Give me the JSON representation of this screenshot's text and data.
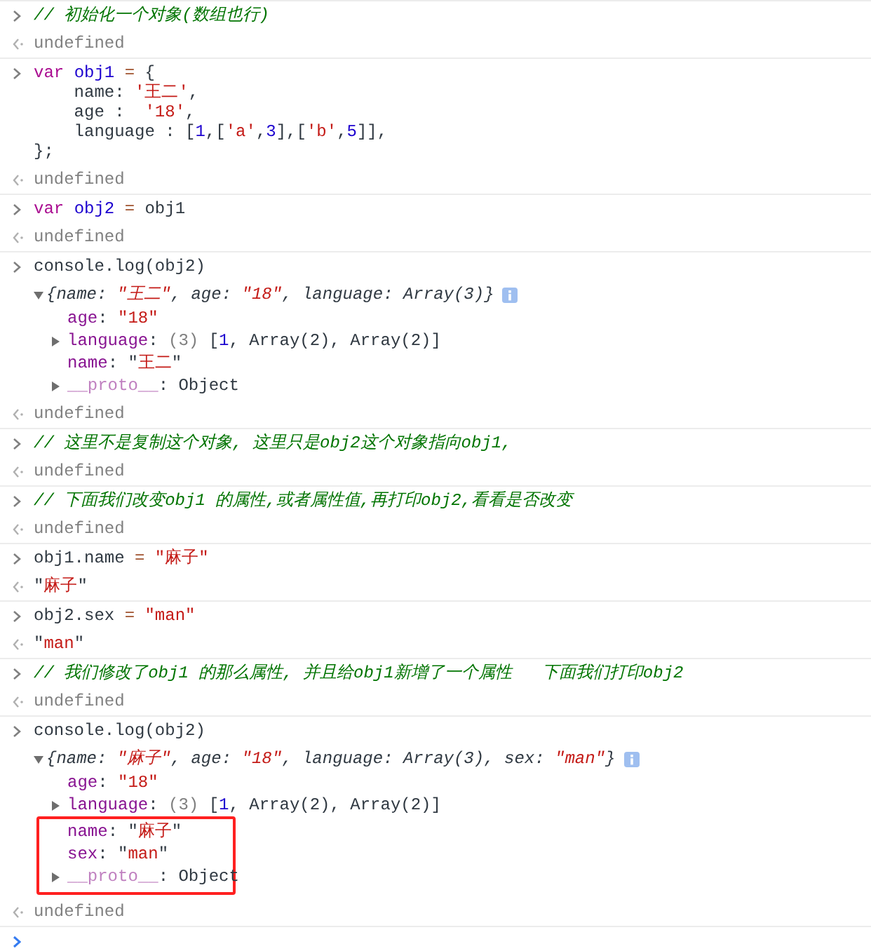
{
  "entries": [
    {
      "input": [
        [
          {
            "text": "// 初始化一个对象(数组也行)",
            "kind": "comment"
          }
        ]
      ],
      "output": [
        {
          "text": "undefined",
          "kind": "dim"
        }
      ]
    },
    {
      "input": [
        [
          {
            "text": "var ",
            "kind": "keyword"
          },
          {
            "text": "obj1 ",
            "kind": "ident"
          },
          {
            "text": "=",
            "kind": "op"
          },
          {
            "text": " {",
            "kind": "plain"
          }
        ],
        [
          {
            "text": "    name: ",
            "kind": "plain"
          },
          {
            "text": "'王二'",
            "kind": "string"
          },
          {
            "text": ",",
            "kind": "plain"
          }
        ],
        [
          {
            "text": "    age :  ",
            "kind": "plain"
          },
          {
            "text": "'18'",
            "kind": "string"
          },
          {
            "text": ",",
            "kind": "plain"
          }
        ],
        [
          {
            "text": "    language : [",
            "kind": "plain"
          },
          {
            "text": "1",
            "kind": "number"
          },
          {
            "text": ",[",
            "kind": "plain"
          },
          {
            "text": "'a'",
            "kind": "string"
          },
          {
            "text": ",",
            "kind": "plain"
          },
          {
            "text": "3",
            "kind": "number"
          },
          {
            "text": "],[",
            "kind": "plain"
          },
          {
            "text": "'b'",
            "kind": "string"
          },
          {
            "text": ",",
            "kind": "plain"
          },
          {
            "text": "5",
            "kind": "number"
          },
          {
            "text": "]],",
            "kind": "plain"
          }
        ],
        [
          {
            "text": "};",
            "kind": "plain"
          }
        ]
      ],
      "output": [
        {
          "text": "undefined",
          "kind": "dim"
        }
      ]
    },
    {
      "input": [
        [
          {
            "text": "var ",
            "kind": "keyword"
          },
          {
            "text": "obj2 ",
            "kind": "ident"
          },
          {
            "text": "=",
            "kind": "op"
          },
          {
            "text": " obj1",
            "kind": "plain"
          }
        ]
      ],
      "output": [
        {
          "text": "undefined",
          "kind": "dim"
        }
      ]
    },
    {
      "input": [
        [
          {
            "text": "console.log(obj2)",
            "kind": "plain"
          }
        ]
      ],
      "log": {
        "expanded": true,
        "summary": [
          {
            "text": "{name: ",
            "kind": "plain"
          },
          {
            "text": "\"王二\"",
            "kind": "string"
          },
          {
            "text": ", age: ",
            "kind": "plain"
          },
          {
            "text": "\"18\"",
            "kind": "string"
          },
          {
            "text": ", language: Array(3)}",
            "kind": "plain"
          }
        ],
        "props": [
          {
            "expandable": false,
            "highlighted": false,
            "tokens": [
              {
                "text": "age",
                "kind": "prop"
              },
              {
                "text": ": ",
                "kind": "plain"
              },
              {
                "text": "\"18\"",
                "kind": "string"
              }
            ]
          },
          {
            "expandable": true,
            "highlighted": false,
            "tokens": [
              {
                "text": "language",
                "kind": "prop"
              },
              {
                "text": ": ",
                "kind": "plain"
              },
              {
                "text": "(3)",
                "kind": "dim"
              },
              {
                "text": " [",
                "kind": "plain"
              },
              {
                "text": "1",
                "kind": "number"
              },
              {
                "text": ", Array(2), Array(2)]",
                "kind": "plain"
              }
            ]
          },
          {
            "expandable": false,
            "highlighted": false,
            "tokens": [
              {
                "text": "name",
                "kind": "prop"
              },
              {
                "text": ": \"",
                "kind": "plain"
              },
              {
                "text": "王二",
                "kind": "string"
              },
              {
                "text": "\"",
                "kind": "plain"
              }
            ]
          },
          {
            "expandable": true,
            "highlighted": false,
            "tokens": [
              {
                "text": "__proto__",
                "kind": "proto"
              },
              {
                "text": ": Object",
                "kind": "plain"
              }
            ]
          }
        ]
      },
      "output": [
        {
          "text": "undefined",
          "kind": "dim"
        }
      ]
    },
    {
      "input": [
        [
          {
            "text": "// 这里不是复制这个对象, 这里只是obj2这个对象指向obj1,",
            "kind": "comment"
          }
        ]
      ],
      "output": [
        {
          "text": "undefined",
          "kind": "dim"
        }
      ]
    },
    {
      "input": [
        [
          {
            "text": "// 下面我们改变obj1 的属性,或者属性值,再打印obj2,看看是否改变",
            "kind": "comment"
          }
        ]
      ],
      "output": [
        {
          "text": "undefined",
          "kind": "dim"
        }
      ]
    },
    {
      "input": [
        [
          {
            "text": "obj1.name ",
            "kind": "plain"
          },
          {
            "text": "= ",
            "kind": "op"
          },
          {
            "text": "\"麻子\"",
            "kind": "string"
          }
        ]
      ],
      "output": [
        {
          "text": "\"",
          "kind": "plain"
        },
        {
          "text": "麻子",
          "kind": "string"
        },
        {
          "text": "\"",
          "kind": "plain"
        }
      ]
    },
    {
      "input": [
        [
          {
            "text": "obj2.sex ",
            "kind": "plain"
          },
          {
            "text": "= ",
            "kind": "op"
          },
          {
            "text": "\"man\"",
            "kind": "string"
          }
        ]
      ],
      "output": [
        {
          "text": "\"",
          "kind": "plain"
        },
        {
          "text": "man",
          "kind": "string"
        },
        {
          "text": "\"",
          "kind": "plain"
        }
      ]
    },
    {
      "input": [
        [
          {
            "text": "// 我们修改了obj1 的那么属性, 并且给obj1新增了一个属性   下面我们打印obj2",
            "kind": "comment"
          }
        ]
      ],
      "output": [
        {
          "text": "undefined",
          "kind": "dim"
        }
      ]
    },
    {
      "input": [
        [
          {
            "text": "console.log(obj2)",
            "kind": "plain"
          }
        ]
      ],
      "log": {
        "expanded": true,
        "summary": [
          {
            "text": "{name: ",
            "kind": "plain"
          },
          {
            "text": "\"麻子\"",
            "kind": "string"
          },
          {
            "text": ", age: ",
            "kind": "plain"
          },
          {
            "text": "\"18\"",
            "kind": "string"
          },
          {
            "text": ", language: Array(3), sex: ",
            "kind": "plain"
          },
          {
            "text": "\"man\"",
            "kind": "string"
          },
          {
            "text": "}",
            "kind": "plain"
          }
        ],
        "props": [
          {
            "expandable": false,
            "highlighted": false,
            "tokens": [
              {
                "text": "age",
                "kind": "prop"
              },
              {
                "text": ": ",
                "kind": "plain"
              },
              {
                "text": "\"18\"",
                "kind": "string"
              }
            ]
          },
          {
            "expandable": true,
            "highlighted": false,
            "tokens": [
              {
                "text": "language",
                "kind": "prop"
              },
              {
                "text": ": ",
                "kind": "plain"
              },
              {
                "text": "(3)",
                "kind": "dim"
              },
              {
                "text": " [",
                "kind": "plain"
              },
              {
                "text": "1",
                "kind": "number"
              },
              {
                "text": ", Array(2), Array(2)]",
                "kind": "plain"
              }
            ]
          },
          {
            "expandable": false,
            "highlighted": true,
            "tokens": [
              {
                "text": "name",
                "kind": "prop"
              },
              {
                "text": ": \"",
                "kind": "plain"
              },
              {
                "text": "麻子",
                "kind": "string"
              },
              {
                "text": "\"",
                "kind": "plain"
              }
            ]
          },
          {
            "expandable": false,
            "highlighted": true,
            "tokens": [
              {
                "text": "sex",
                "kind": "prop"
              },
              {
                "text": ": \"",
                "kind": "plain"
              },
              {
                "text": "man",
                "kind": "string"
              },
              {
                "text": "\"",
                "kind": "plain"
              }
            ]
          },
          {
            "expandable": true,
            "highlighted": true,
            "tokens": [
              {
                "text": "__proto__",
                "kind": "proto"
              },
              {
                "text": ": Object",
                "kind": "plain"
              }
            ]
          }
        ]
      },
      "output": [
        {
          "text": "undefined",
          "kind": "dim"
        }
      ]
    }
  ]
}
